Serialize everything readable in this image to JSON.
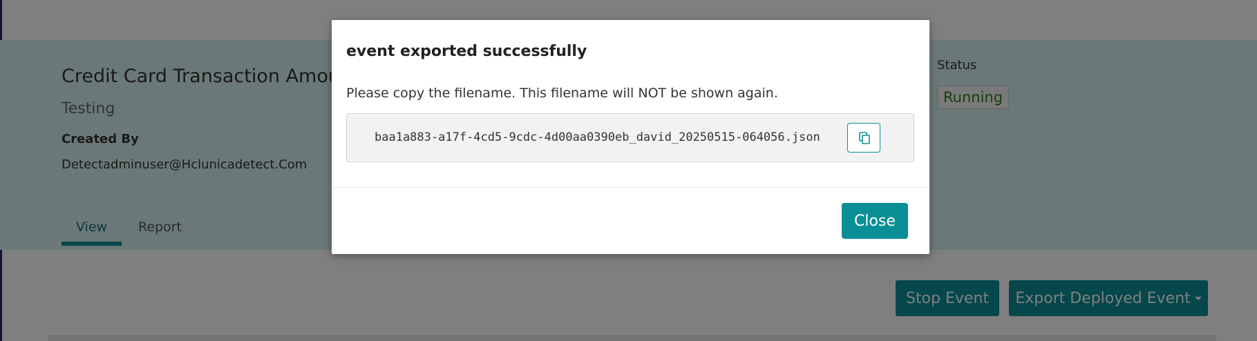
{
  "page": {
    "event_title": "Credit Card Transaction Amou",
    "event_subtitle": "Testing",
    "created_by_label": "Created By",
    "created_by_value": "Detectadminuser@Hclunicadetect.Com",
    "status_label": "Status",
    "status_value": "Running",
    "tabs": [
      {
        "label": "View",
        "active": true
      },
      {
        "label": "Report",
        "active": false
      }
    ],
    "stop_button": "Stop Event",
    "export_button": "Export Deployed Event"
  },
  "modal": {
    "title": "event exported successfully",
    "message": "Please copy the filename. This filename will NOT be shown again.",
    "filename": "baa1a883-a17f-4cd5-9cdc-4d00aa0390eb_david_20250515-064056.json",
    "copy_icon": "copy-icon",
    "close_button": "Close"
  },
  "colors": {
    "accent": "#0b8f96",
    "hero_background": "#d7f1f0",
    "status_text": "#2e7d1b"
  }
}
